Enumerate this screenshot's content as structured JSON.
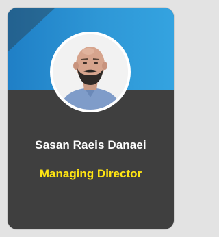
{
  "profile": {
    "name": "Sasan Raeis Danaei",
    "role": "Managing Director"
  },
  "colors": {
    "header_blue": "#2e97d6",
    "card_dark": "#3f3f3f",
    "role_yellow": "#ffe512",
    "name_white": "#ffffff"
  },
  "icons": {
    "avatar": "profile-photo"
  }
}
